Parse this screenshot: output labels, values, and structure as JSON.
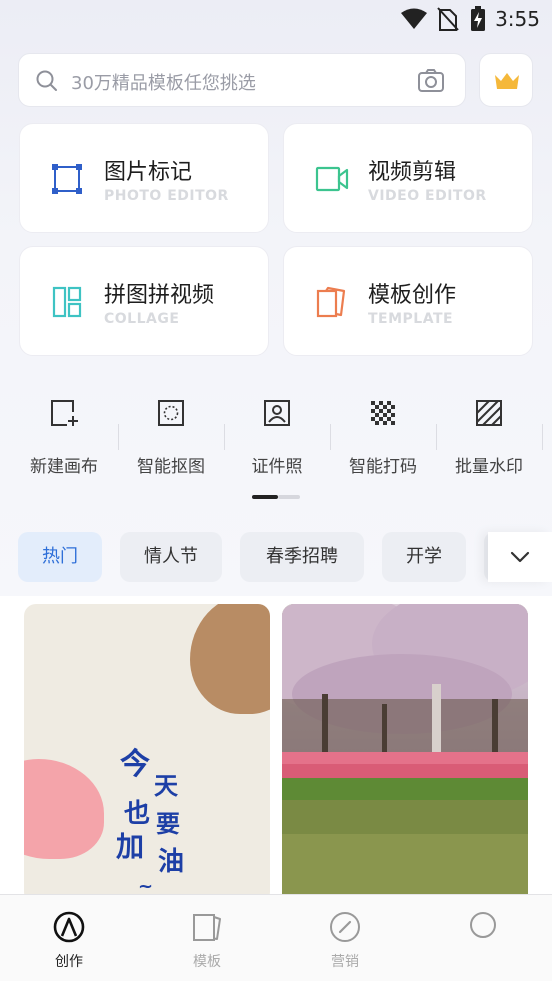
{
  "status_bar": {
    "time": "3:55"
  },
  "search": {
    "placeholder": "30万精品模板任您挑选"
  },
  "feature_cards": [
    {
      "title": "图片标记",
      "subtitle": "PHOTO EDITOR",
      "icon": "crop-frame-icon",
      "color": "#2f5fc9"
    },
    {
      "title": "视频剪辑",
      "subtitle": "VIDEO EDITOR",
      "icon": "video-camera-icon",
      "color": "#3cc48f"
    },
    {
      "title": "拼图拼视频",
      "subtitle": "COLLAGE",
      "icon": "collage-layout-icon",
      "color": "#3ec3c3"
    },
    {
      "title": "模板创作",
      "subtitle": "TEMPLATE",
      "icon": "template-pages-icon",
      "color": "#ec7d4f"
    }
  ],
  "tools": [
    {
      "label": "新建画布",
      "icon": "new-canvas-icon"
    },
    {
      "label": "智能抠图",
      "icon": "smart-cutout-icon"
    },
    {
      "label": "证件照",
      "icon": "id-photo-icon"
    },
    {
      "label": "智能打码",
      "icon": "mosaic-icon"
    },
    {
      "label": "批量水印",
      "icon": "watermark-icon"
    }
  ],
  "categories": [
    {
      "label": "热门",
      "active": true
    },
    {
      "label": "情人节",
      "active": false
    },
    {
      "label": "春季招聘",
      "active": false
    },
    {
      "label": "开学",
      "active": false
    }
  ],
  "templates": [
    {
      "text_lines": [
        "今",
        "天",
        "也",
        "要",
        "加",
        "油",
        "~"
      ]
    }
  ],
  "bottom_nav": [
    {
      "label": "创作",
      "icon": "create-icon",
      "active": true
    },
    {
      "label": "模板",
      "icon": "template-icon",
      "active": false
    },
    {
      "label": "营销",
      "icon": "marketing-icon",
      "active": false
    },
    {
      "label": "",
      "icon": "profile-icon",
      "active": false
    }
  ],
  "colors": {
    "accent_blue": "#2e6fd8",
    "vip_gold": "#f5b83a"
  }
}
